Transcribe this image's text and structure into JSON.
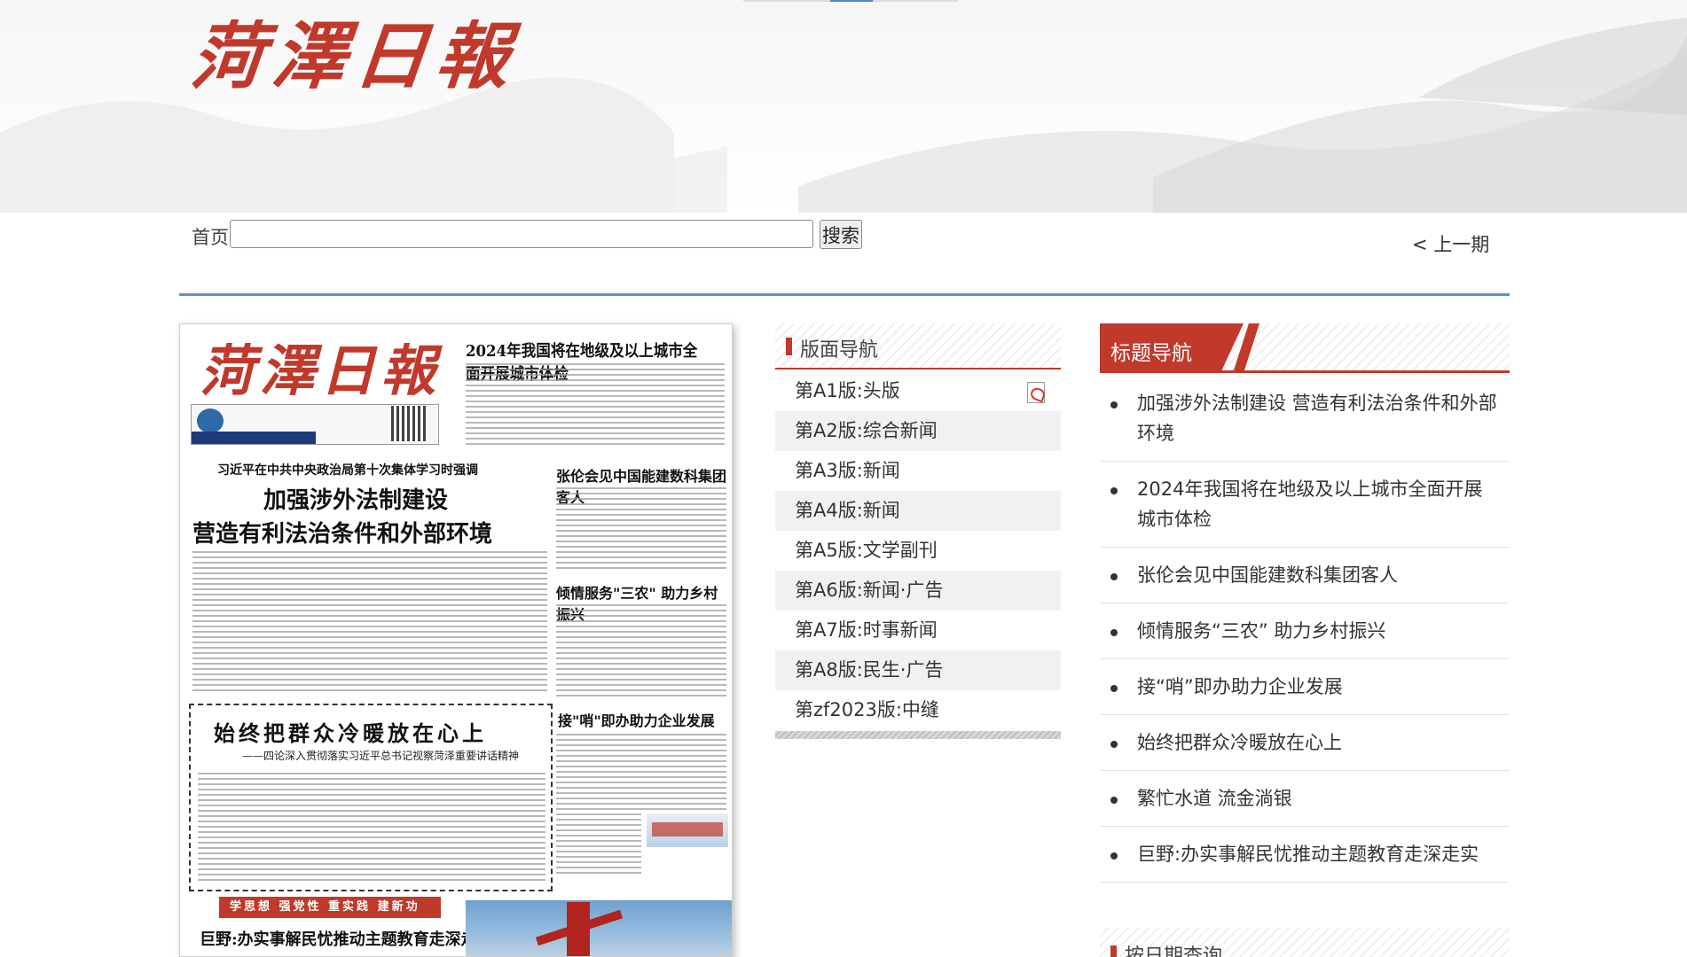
{
  "banner": {
    "logo": "菏澤日報"
  },
  "search": {
    "home_label": "首页",
    "input_value": "",
    "button_label": "搜索"
  },
  "prev_issue_label": "< 上一期",
  "paper_image": {
    "logo": "菏澤日報",
    "headline_top": "2024年我国将在地级及以上城市全面开展城市体检",
    "kicker": "习近平在中共中央政治局第十次集体学习时强调",
    "lead_line1": "加强涉外法制建设",
    "lead_line2": "营造有利法治条件和外部环境",
    "side1": "张伦会见中国能建数科集团客人",
    "side2": "倾情服务\"三农\" 助力乡村振兴",
    "side3": "接\"哨\"即办助力企业发展",
    "boxed_title": "始终把群众冷暖放在心上",
    "boxed_sub": "——四论深入贯彻落实习近平总书记视察菏泽重要讲话精神",
    "band": "学思想 强党性 重实践 建新功",
    "bottom_title": "巨野:办实事解民忧推动主题教育走深走实"
  },
  "edition_nav": {
    "title": "版面导航",
    "items": [
      {
        "label": "第A1版:头版",
        "pdf": true
      },
      {
        "label": "第A2版:综合新闻"
      },
      {
        "label": "第A3版:新闻"
      },
      {
        "label": "第A4版:新闻"
      },
      {
        "label": "第A5版:文学副刊"
      },
      {
        "label": "第A6版:新闻·广告"
      },
      {
        "label": "第A7版:时事新闻"
      },
      {
        "label": "第A8版:民生·广告"
      },
      {
        "label": "第zf2023版:中缝"
      }
    ]
  },
  "title_nav": {
    "title": "标题导航",
    "items": [
      "加强涉外法制建设 营造有利法治条件和外部环境",
      "2024年我国将在地级及以上城市全面开展城市体检",
      "张伦会见中国能建数科集团客人",
      "倾情服务“三农” 助力乡村振兴",
      "接“哨”即办助力企业发展",
      "始终把群众冷暖放在心上",
      "繁忙水道 流金淌银",
      "巨野:办实事解民忧推动主题教育走深走实"
    ]
  },
  "date_query": {
    "title": "按日期查询"
  },
  "colors": {
    "accent_red": "#c0392b",
    "rule_blue": "#5b8fcf"
  }
}
